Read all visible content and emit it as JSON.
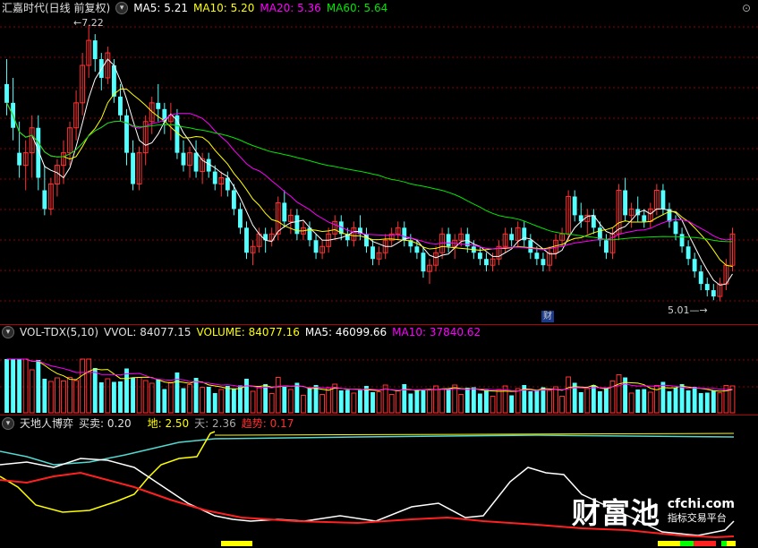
{
  "main": {
    "title": "汇嘉时代(日线 前复权)",
    "ma5": "MA5: 5.21",
    "ma10": "MA10: 5.20",
    "ma20": "MA20: 5.36",
    "ma60": "MA60: 5.64",
    "high_label": "7.22",
    "low_label": "5.01",
    "cai_tag": "财"
  },
  "volume": {
    "title": "VOL-TDX(5,10)",
    "vvol": "VVOL: 84077.15",
    "volume": "VOLUME: 84077.16",
    "ma5": "MA5: 46099.66",
    "ma10": "MA10: 37840.62"
  },
  "indicator": {
    "title": "天地人博弈",
    "maimai": "买卖: 0.20",
    "di": "地: 2.50",
    "tian": "天: 2.36",
    "qushi": "趋势: 0.17"
  },
  "watermark": {
    "brand": "财富池",
    "domain": "cfchi.com",
    "tagline": "指标交易平台"
  },
  "colors": {
    "up": "#ff3232",
    "down": "#54ffff",
    "ma5": "#ffffff",
    "ma10": "#ffff00",
    "ma20": "#ff00ff",
    "ma60": "#00e600",
    "grid": "#8b0000",
    "white_line": "#ffffff",
    "yellow_line": "#ffff00",
    "red_line": "#ff2020",
    "cyan_line": "#54d8d0"
  },
  "ohlc": [
    [
      6.75,
      6.95,
      6.5,
      6.6
    ],
    [
      6.6,
      6.8,
      6.3,
      6.4
    ],
    [
      6.2,
      6.45,
      6.0,
      6.1
    ],
    [
      6.1,
      6.3,
      5.9,
      6.2
    ],
    [
      6.2,
      6.5,
      6.0,
      6.4
    ],
    [
      6.4,
      6.5,
      5.9,
      6.0
    ],
    [
      5.9,
      6.1,
      5.7,
      5.75
    ],
    [
      5.75,
      6.0,
      5.7,
      5.95
    ],
    [
      5.95,
      6.15,
      5.85,
      6.1
    ],
    [
      6.1,
      6.3,
      5.95,
      6.2
    ],
    [
      6.2,
      6.45,
      6.1,
      6.4
    ],
    [
      6.4,
      6.7,
      6.3,
      6.6
    ],
    [
      6.6,
      7.0,
      6.5,
      6.9
    ],
    [
      6.9,
      7.22,
      6.8,
      7.1
    ],
    [
      7.1,
      7.15,
      6.85,
      6.95
    ],
    [
      6.95,
      7.0,
      6.7,
      6.8
    ],
    [
      6.8,
      7.05,
      6.75,
      7.0
    ],
    [
      6.9,
      6.95,
      6.6,
      6.65
    ],
    [
      6.65,
      6.75,
      6.45,
      6.5
    ],
    [
      6.5,
      6.55,
      6.1,
      6.2
    ],
    [
      6.2,
      6.3,
      5.9,
      5.95
    ],
    [
      5.95,
      6.25,
      5.9,
      6.2
    ],
    [
      6.2,
      6.5,
      6.1,
      6.45
    ],
    [
      6.45,
      6.65,
      6.35,
      6.6
    ],
    [
      6.6,
      6.75,
      6.45,
      6.55
    ],
    [
      6.55,
      6.6,
      6.35,
      6.45
    ],
    [
      6.45,
      6.6,
      6.3,
      6.5
    ],
    [
      6.5,
      6.55,
      6.15,
      6.2
    ],
    [
      6.2,
      6.3,
      6.05,
      6.1
    ],
    [
      6.1,
      6.25,
      6.0,
      6.2
    ],
    [
      6.2,
      6.3,
      6.0,
      6.05
    ],
    [
      6.05,
      6.2,
      5.95,
      6.15
    ],
    [
      6.15,
      6.2,
      6.0,
      6.05
    ],
    [
      6.05,
      6.1,
      5.9,
      5.95
    ],
    [
      5.95,
      6.05,
      5.85,
      6.0
    ],
    [
      6.0,
      6.05,
      5.85,
      5.9
    ],
    [
      5.9,
      5.95,
      5.7,
      5.75
    ],
    [
      5.75,
      5.8,
      5.55,
      5.6
    ],
    [
      5.6,
      5.65,
      5.35,
      5.4
    ],
    [
      5.4,
      5.5,
      5.3,
      5.45
    ],
    [
      5.45,
      5.6,
      5.4,
      5.55
    ],
    [
      5.55,
      5.6,
      5.4,
      5.5
    ],
    [
      5.5,
      5.6,
      5.45,
      5.55
    ],
    [
      5.55,
      5.85,
      5.5,
      5.8
    ],
    [
      5.8,
      5.9,
      5.6,
      5.65
    ],
    [
      5.65,
      5.75,
      5.55,
      5.7
    ],
    [
      5.7,
      5.75,
      5.5,
      5.55
    ],
    [
      5.55,
      5.65,
      5.5,
      5.6
    ],
    [
      5.6,
      5.65,
      5.45,
      5.5
    ],
    [
      5.5,
      5.55,
      5.35,
      5.4
    ],
    [
      5.4,
      5.5,
      5.35,
      5.45
    ],
    [
      5.45,
      5.6,
      5.4,
      5.55
    ],
    [
      5.55,
      5.7,
      5.5,
      5.65
    ],
    [
      5.65,
      5.7,
      5.5,
      5.55
    ],
    [
      5.55,
      5.6,
      5.45,
      5.5
    ],
    [
      5.5,
      5.65,
      5.45,
      5.6
    ],
    [
      5.6,
      5.7,
      5.5,
      5.55
    ],
    [
      5.55,
      5.6,
      5.4,
      5.45
    ],
    [
      5.45,
      5.5,
      5.3,
      5.35
    ],
    [
      5.35,
      5.45,
      5.3,
      5.4
    ],
    [
      5.4,
      5.55,
      5.35,
      5.5
    ],
    [
      5.5,
      5.6,
      5.45,
      5.55
    ],
    [
      5.55,
      5.65,
      5.5,
      5.6
    ],
    [
      5.6,
      5.65,
      5.45,
      5.5
    ],
    [
      5.5,
      5.55,
      5.4,
      5.45
    ],
    [
      5.45,
      5.5,
      5.35,
      5.4
    ],
    [
      5.4,
      5.45,
      5.2,
      5.25
    ],
    [
      5.25,
      5.35,
      5.15,
      5.3
    ],
    [
      5.3,
      5.45,
      5.25,
      5.4
    ],
    [
      5.4,
      5.6,
      5.35,
      5.55
    ],
    [
      5.55,
      5.6,
      5.4,
      5.45
    ],
    [
      5.45,
      5.55,
      5.35,
      5.5
    ],
    [
      5.5,
      5.6,
      5.45,
      5.55
    ],
    [
      5.55,
      5.6,
      5.4,
      5.45
    ],
    [
      5.45,
      5.5,
      5.35,
      5.4
    ],
    [
      5.4,
      5.45,
      5.3,
      5.35
    ],
    [
      5.35,
      5.4,
      5.25,
      5.3
    ],
    [
      5.3,
      5.4,
      5.25,
      5.35
    ],
    [
      5.35,
      5.5,
      5.3,
      5.45
    ],
    [
      5.45,
      5.6,
      5.4,
      5.55
    ],
    [
      5.55,
      5.6,
      5.45,
      5.5
    ],
    [
      5.5,
      5.65,
      5.45,
      5.6
    ],
    [
      5.6,
      5.65,
      5.45,
      5.5
    ],
    [
      5.5,
      5.55,
      5.35,
      5.4
    ],
    [
      5.4,
      5.45,
      5.3,
      5.35
    ],
    [
      5.35,
      5.4,
      5.25,
      5.3
    ],
    [
      5.3,
      5.45,
      5.25,
      5.4
    ],
    [
      5.4,
      5.55,
      5.35,
      5.5
    ],
    [
      5.5,
      5.6,
      5.45,
      5.55
    ],
    [
      5.55,
      5.9,
      5.5,
      5.85
    ],
    [
      5.85,
      5.9,
      5.65,
      5.7
    ],
    [
      5.7,
      5.8,
      5.6,
      5.65
    ],
    [
      5.65,
      5.75,
      5.55,
      5.7
    ],
    [
      5.7,
      5.75,
      5.55,
      5.6
    ],
    [
      5.6,
      5.65,
      5.45,
      5.5
    ],
    [
      5.5,
      5.55,
      5.35,
      5.4
    ],
    [
      5.4,
      5.6,
      5.35,
      5.55
    ],
    [
      5.55,
      5.95,
      5.5,
      5.9
    ],
    [
      5.9,
      6.0,
      5.65,
      5.7
    ],
    [
      5.7,
      5.8,
      5.6,
      5.75
    ],
    [
      5.75,
      5.85,
      5.65,
      5.7
    ],
    [
      5.7,
      5.75,
      5.6,
      5.65
    ],
    [
      5.65,
      5.8,
      5.6,
      5.75
    ],
    [
      5.75,
      5.95,
      5.7,
      5.9
    ],
    [
      5.9,
      5.95,
      5.7,
      5.75
    ],
    [
      5.75,
      5.8,
      5.6,
      5.65
    ],
    [
      5.65,
      5.7,
      5.5,
      5.55
    ],
    [
      5.55,
      5.6,
      5.4,
      5.45
    ],
    [
      5.45,
      5.5,
      5.3,
      5.35
    ],
    [
      5.35,
      5.4,
      5.2,
      5.25
    ],
    [
      5.25,
      5.3,
      5.1,
      5.15
    ],
    [
      5.15,
      5.2,
      5.05,
      5.1
    ],
    [
      5.1,
      5.15,
      5.02,
      5.05
    ],
    [
      5.05,
      5.2,
      5.01,
      5.15
    ],
    [
      5.15,
      5.35,
      5.1,
      5.3
    ],
    [
      5.3,
      5.6,
      5.25,
      5.55
    ]
  ]
}
